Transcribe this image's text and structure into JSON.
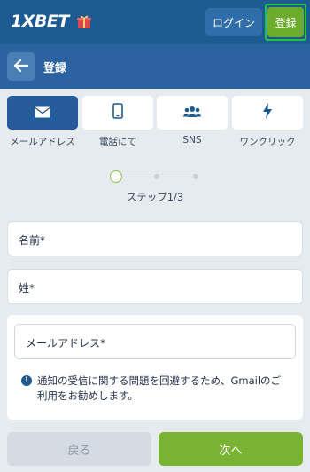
{
  "header": {
    "logo_text": "1XBET",
    "login_label": "ログイン",
    "register_label": "登録"
  },
  "subheader": {
    "title": "登録"
  },
  "tabs": [
    {
      "label": "メールアドレス",
      "icon": "mail-icon",
      "active": true
    },
    {
      "label": "電話にて",
      "icon": "phone-icon",
      "active": false
    },
    {
      "label": "SNS",
      "icon": "people-icon",
      "active": false
    },
    {
      "label": "ワンクリック",
      "icon": "lightning-icon",
      "active": false
    }
  ],
  "stepper": {
    "label": "ステップ1/3",
    "current": 1,
    "total": 3
  },
  "form": {
    "first_name_label": "名前*",
    "last_name_label": "姓*",
    "email_label": "メールアドレス*",
    "notice": "通知の受信に関する問題を回避するため、Gmailのご利用をお勧めします。"
  },
  "buttons": {
    "back_label": "戻る",
    "next_label": "次へ"
  },
  "colors": {
    "header_bg": "#1e5a92",
    "accent_green": "#7ab334",
    "active_tab": "#235c99"
  }
}
